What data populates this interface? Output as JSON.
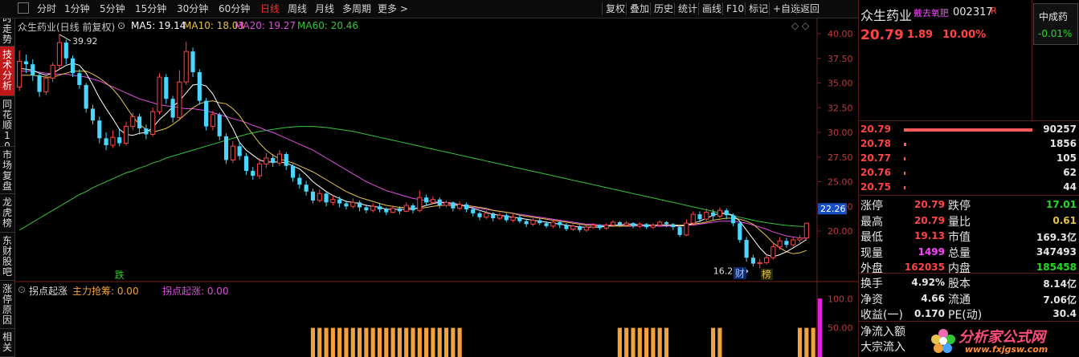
{
  "toolbar": {
    "periods": [
      "分时",
      "1分钟",
      "5分钟",
      "15分钟",
      "30分钟",
      "60分钟",
      "日线",
      "周线",
      "月线",
      "多周期",
      "更多 >"
    ],
    "active_period": "日线",
    "actions": [
      "复权",
      "叠加",
      "历史",
      "统计",
      "画线",
      "F10",
      "标记",
      "+自选",
      "返回"
    ]
  },
  "left_tabs": [
    "分时走势",
    "技术分析",
    "同花顺10",
    "市场复盘",
    "龙虎榜",
    "东财股吧",
    "涨停原因",
    "相关"
  ],
  "active_left_tab": "技术分析",
  "chart": {
    "title": "众生药业(日线 前复权)",
    "ma_legend": [
      {
        "label": "MA5: 19.14",
        "color": "#ffffff"
      },
      {
        "label": "MA10: 18.03",
        "color": "#e6c34a"
      },
      {
        "label": "MA20: 19.27",
        "color": "#e04ce0"
      },
      {
        "label": "MA60: 20.46",
        "color": "#36c436"
      }
    ],
    "price_axis": [
      "40.00",
      "37.50",
      "35.00",
      "32.50",
      "30.00",
      "27.50",
      "25.00",
      "22.50",
      "20.00"
    ],
    "current_price_tag": "22.26",
    "high_label": "39.92",
    "low_label": "16.23",
    "markers": {
      "die": "跌",
      "cai": "财",
      "bang": "榜"
    },
    "indicator_legend": {
      "name": "拐点起涨",
      "zljc": "主力抢筹: 0.00",
      "gdqz": "拐点起涨: 0.00"
    },
    "indicator_axis": [
      "100.0",
      "50.00"
    ],
    "colors": {
      "up": "#ff4444",
      "down": "#4ad6ff",
      "ma5": "#ffffff",
      "ma10": "#e6c34a",
      "ma20": "#e04ce0",
      "ma60": "#36c436",
      "bar": "#f2a23a",
      "bar_peak": "#e020e0"
    }
  },
  "chart_data": {
    "type": "candlestick",
    "ylim": [
      16,
      41
    ],
    "candles": [
      [
        34.6,
        37.2,
        38.3,
        34.2
      ],
      [
        37.2,
        36.9,
        37.9,
        36.0
      ],
      [
        36.9,
        35.8,
        37.4,
        35.2
      ],
      [
        35.8,
        34.1,
        36.1,
        33.6
      ],
      [
        34.1,
        35.5,
        35.9,
        33.8
      ],
      [
        35.5,
        36.8,
        37.1,
        35.1
      ],
      [
        36.8,
        39.1,
        39.92,
        36.4
      ],
      [
        39.1,
        37.5,
        39.4,
        36.9
      ],
      [
        37.5,
        36.0,
        37.8,
        35.6
      ],
      [
        36.0,
        34.8,
        36.4,
        34.4
      ],
      [
        34.8,
        32.4,
        35.0,
        32.0
      ],
      [
        32.4,
        31.2,
        32.8,
        30.8
      ],
      [
        31.2,
        29.4,
        31.6,
        28.9
      ],
      [
        29.4,
        28.7,
        30.0,
        28.2
      ],
      [
        28.7,
        29.5,
        30.2,
        28.4
      ],
      [
        29.5,
        28.9,
        30.3,
        28.6
      ],
      [
        28.9,
        30.6,
        31.1,
        28.7
      ],
      [
        30.6,
        31.6,
        32.0,
        30.2
      ],
      [
        31.6,
        30.4,
        31.9,
        29.8
      ],
      [
        30.4,
        29.8,
        30.8,
        29.3
      ],
      [
        29.8,
        32.1,
        32.5,
        29.6
      ],
      [
        32.1,
        35.6,
        36.0,
        31.8
      ],
      [
        35.6,
        33.4,
        35.9,
        32.9
      ],
      [
        33.4,
        31.5,
        33.7,
        31.0
      ],
      [
        31.5,
        35.1,
        36.3,
        31.2
      ],
      [
        35.1,
        38.2,
        39.2,
        34.8
      ],
      [
        38.2,
        36.1,
        38.6,
        35.6
      ],
      [
        36.1,
        33.2,
        36.4,
        32.8
      ],
      [
        33.2,
        30.6,
        33.5,
        30.2
      ],
      [
        30.6,
        31.8,
        32.2,
        30.2
      ],
      [
        31.8,
        29.6,
        32.0,
        29.2
      ],
      [
        29.6,
        27.2,
        29.9,
        26.8
      ],
      [
        27.2,
        28.6,
        29.1,
        26.9
      ],
      [
        28.6,
        27.6,
        29.0,
        27.2
      ],
      [
        27.6,
        26.1,
        27.9,
        25.7
      ],
      [
        26.1,
        25.6,
        26.5,
        25.2
      ],
      [
        25.6,
        26.8,
        27.4,
        25.3
      ],
      [
        26.8,
        27.4,
        27.9,
        26.4
      ],
      [
        27.4,
        26.9,
        27.8,
        26.5
      ],
      [
        26.9,
        27.8,
        28.2,
        26.6
      ],
      [
        27.8,
        26.6,
        28.0,
        26.2
      ],
      [
        26.6,
        25.4,
        26.8,
        25.0
      ],
      [
        25.4,
        24.7,
        25.8,
        24.3
      ],
      [
        24.7,
        24.0,
        25.1,
        23.6
      ],
      [
        24.0,
        23.1,
        24.3,
        22.8
      ],
      [
        23.1,
        23.8,
        24.2,
        22.9
      ],
      [
        23.8,
        22.9,
        24.0,
        22.5
      ],
      [
        22.9,
        23.2,
        23.6,
        22.6
      ],
      [
        23.2,
        22.8,
        23.5,
        22.4
      ],
      [
        22.8,
        22.5,
        23.1,
        22.2
      ],
      [
        22.5,
        22.9,
        23.3,
        22.3
      ],
      [
        22.9,
        22.4,
        23.1,
        22.0
      ],
      [
        22.4,
        22.1,
        22.7,
        21.8
      ],
      [
        22.1,
        22.5,
        22.8,
        21.9
      ],
      [
        22.5,
        22.2,
        22.8,
        21.9
      ],
      [
        22.2,
        21.9,
        22.4,
        21.6
      ],
      [
        21.9,
        22.3,
        22.6,
        21.8
      ],
      [
        22.3,
        22.0,
        22.5,
        21.7
      ],
      [
        22.0,
        22.6,
        22.9,
        21.9
      ],
      [
        22.6,
        22.1,
        22.8,
        21.8
      ],
      [
        22.1,
        23.4,
        24.1,
        21.9
      ],
      [
        23.4,
        22.9,
        23.7,
        22.6
      ],
      [
        22.9,
        23.2,
        23.5,
        22.7
      ],
      [
        23.2,
        22.6,
        23.4,
        22.3
      ],
      [
        22.6,
        22.9,
        23.1,
        22.4
      ],
      [
        22.9,
        22.3,
        23.0,
        22.0
      ],
      [
        22.3,
        22.7,
        23.0,
        22.1
      ],
      [
        22.7,
        22.2,
        22.9,
        21.9
      ],
      [
        22.2,
        21.8,
        22.4,
        21.5
      ],
      [
        21.8,
        21.4,
        22.0,
        21.1
      ],
      [
        21.4,
        21.8,
        22.1,
        21.2
      ],
      [
        21.8,
        21.3,
        21.9,
        21.0
      ],
      [
        21.3,
        21.6,
        21.9,
        21.1
      ],
      [
        21.6,
        21.1,
        21.8,
        20.9
      ],
      [
        21.1,
        21.4,
        21.7,
        20.9
      ],
      [
        21.4,
        21.0,
        21.6,
        20.8
      ],
      [
        21.0,
        20.7,
        21.2,
        20.4
      ],
      [
        20.7,
        21.1,
        21.3,
        20.5
      ],
      [
        21.1,
        20.8,
        21.3,
        20.6
      ],
      [
        20.8,
        20.5,
        21.0,
        20.3
      ],
      [
        20.5,
        20.9,
        21.1,
        20.3
      ],
      [
        20.9,
        20.6,
        21.0,
        20.3
      ],
      [
        20.6,
        20.2,
        20.8,
        20.0
      ],
      [
        20.2,
        20.5,
        20.7,
        20.0
      ],
      [
        20.5,
        20.1,
        20.6,
        19.9
      ],
      [
        20.1,
        20.4,
        20.6,
        19.9
      ],
      [
        20.4,
        20.6,
        20.8,
        20.2
      ],
      [
        20.6,
        20.3,
        20.7,
        20.1
      ],
      [
        20.3,
        20.6,
        20.8,
        20.1
      ],
      [
        20.6,
        20.9,
        21.1,
        20.4
      ],
      [
        20.9,
        20.6,
        21.0,
        20.4
      ],
      [
        20.6,
        20.8,
        21.0,
        20.4
      ],
      [
        20.8,
        20.5,
        20.9,
        20.3
      ],
      [
        20.5,
        20.7,
        20.9,
        20.3
      ],
      [
        20.7,
        20.4,
        20.8,
        20.2
      ],
      [
        20.4,
        20.6,
        20.8,
        20.2
      ],
      [
        20.6,
        20.9,
        21.1,
        20.4
      ],
      [
        20.9,
        20.7,
        21.0,
        20.4
      ],
      [
        20.7,
        20.4,
        20.8,
        20.1
      ],
      [
        20.4,
        19.6,
        20.5,
        19.4
      ],
      [
        19.6,
        20.8,
        21.2,
        19.5
      ],
      [
        20.8,
        21.7,
        22.0,
        20.6
      ],
      [
        21.7,
        21.2,
        22.0,
        20.9
      ],
      [
        21.2,
        21.9,
        22.3,
        21.0
      ],
      [
        21.9,
        21.5,
        22.2,
        21.1
      ],
      [
        21.5,
        22.1,
        22.4,
        21.3
      ],
      [
        22.1,
        21.6,
        22.3,
        21.2
      ],
      [
        21.6,
        20.8,
        21.8,
        20.5
      ],
      [
        20.8,
        19.1,
        21.0,
        18.8
      ],
      [
        19.1,
        17.3,
        19.4,
        16.9
      ],
      [
        17.3,
        16.7,
        17.6,
        16.4
      ],
      [
        16.7,
        16.8,
        17.2,
        16.23
      ],
      [
        16.8,
        17.3,
        17.6,
        16.6
      ],
      [
        17.3,
        18.4,
        18.7,
        17.1
      ],
      [
        18.4,
        19.0,
        19.4,
        18.1
      ],
      [
        19.0,
        18.6,
        19.3,
        18.3
      ],
      [
        18.6,
        19.1,
        19.4,
        18.4
      ],
      [
        19.1,
        19.3,
        19.6,
        18.8
      ],
      [
        19.3,
        20.79,
        20.79,
        19.13
      ]
    ],
    "ma5": [
      36.5,
      36.4,
      36.3,
      36.0,
      35.8,
      36.0,
      36.4,
      36.8,
      37.0,
      36.8,
      36.0,
      34.8,
      33.5,
      32.4,
      31.4,
      30.3,
      29.8,
      29.7,
      29.9,
      30.0,
      30.5,
      31.3,
      31.9,
      32.6,
      33.2,
      34.0,
      34.8,
      34.9,
      34.7,
      33.9,
      32.6,
      31.6,
      30.4,
      29.0,
      28.2,
      27.7,
      27.2,
      27.0,
      27.0,
      27.0,
      26.9,
      26.6,
      26.3,
      25.7,
      25.0,
      24.5,
      24.0,
      23.6,
      23.3,
      23.0,
      22.9,
      22.8,
      22.6,
      22.5,
      22.4,
      22.2,
      22.2,
      22.2,
      22.2,
      22.2,
      22.4,
      22.6,
      22.8,
      22.9,
      22.9,
      22.8,
      22.7,
      22.5,
      22.3,
      22.1,
      21.9,
      21.7,
      21.6,
      21.5,
      21.4,
      21.3,
      21.2,
      21.1,
      21.0,
      20.9,
      20.8,
      20.7,
      20.6,
      20.5,
      20.4,
      20.4,
      20.4,
      20.4,
      20.5,
      20.6,
      20.6,
      20.7,
      20.7,
      20.6,
      20.6,
      20.6,
      20.6,
      20.6,
      20.6,
      20.5,
      20.6,
      20.8,
      21.0,
      21.3,
      21.6,
      21.8,
      21.8,
      21.6,
      21.0,
      20.1,
      19.2,
      18.3,
      17.6,
      17.4,
      17.6,
      17.9,
      18.3,
      18.7,
      19.14
    ],
    "ma10": [
      35.8,
      35.8,
      35.8,
      35.7,
      35.6,
      35.6,
      35.8,
      36.0,
      36.2,
      36.2,
      36.2,
      35.9,
      35.5,
      35.0,
      34.4,
      33.6,
      32.6,
      31.6,
      30.8,
      30.3,
      30.0,
      30.2,
      30.4,
      30.8,
      31.3,
      31.9,
      32.5,
      32.9,
      33.1,
      33.2,
      33.0,
      32.9,
      32.4,
      31.7,
      30.7,
      29.8,
      28.9,
      28.2,
      27.7,
      27.3,
      27.1,
      26.9,
      26.6,
      26.3,
      26.0,
      25.6,
      25.2,
      24.8,
      24.4,
      24.0,
      23.7,
      23.4,
      23.2,
      23.0,
      22.8,
      22.6,
      22.5,
      22.4,
      22.4,
      22.3,
      22.3,
      22.4,
      22.5,
      22.6,
      22.6,
      22.6,
      22.6,
      22.6,
      22.5,
      22.4,
      22.3,
      22.1,
      22.0,
      21.9,
      21.8,
      21.6,
      21.5,
      21.4,
      21.3,
      21.2,
      21.1,
      21.0,
      20.9,
      20.8,
      20.7,
      20.6,
      20.6,
      20.5,
      20.5,
      20.5,
      20.5,
      20.5,
      20.6,
      20.6,
      20.6,
      20.6,
      20.6,
      20.6,
      20.6,
      20.6,
      20.6,
      20.7,
      20.8,
      20.9,
      21.1,
      21.2,
      21.3,
      21.3,
      21.2,
      21.0,
      20.7,
      20.1,
      19.5,
      18.8,
      18.3,
      17.9,
      17.7,
      17.8,
      18.03
    ],
    "ma20": [
      36.2,
      36.2,
      36.2,
      36.1,
      36.0,
      35.9,
      35.9,
      35.9,
      35.8,
      35.7,
      35.6,
      35.4,
      35.2,
      34.9,
      34.6,
      34.3,
      34.0,
      33.7,
      33.4,
      33.2,
      33.0,
      32.8,
      32.7,
      32.6,
      32.5,
      32.4,
      32.4,
      32.3,
      32.2,
      32.0,
      31.8,
      31.6,
      31.4,
      31.2,
      31.0,
      30.7,
      30.5,
      30.2,
      30.0,
      29.7,
      29.4,
      29.1,
      28.8,
      28.5,
      28.2,
      27.8,
      27.4,
      27.0,
      26.6,
      26.2,
      25.8,
      25.4,
      25.0,
      24.7,
      24.4,
      24.1,
      23.9,
      23.7,
      23.5,
      23.3,
      23.2,
      23.1,
      23.0,
      22.9,
      22.8,
      22.7,
      22.6,
      22.5,
      22.4,
      22.3,
      22.2,
      22.1,
      22.0,
      21.9,
      21.8,
      21.7,
      21.6,
      21.5,
      21.4,
      21.3,
      21.2,
      21.1,
      21.0,
      20.9,
      20.8,
      20.7,
      20.7,
      20.6,
      20.6,
      20.6,
      20.6,
      20.5,
      20.5,
      20.5,
      20.5,
      20.5,
      20.5,
      20.5,
      20.5,
      20.5,
      20.6,
      20.6,
      20.7,
      20.8,
      20.9,
      21.0,
      21.0,
      21.0,
      20.9,
      20.8,
      20.6,
      20.4,
      20.2,
      19.9,
      19.7,
      19.5,
      19.4,
      19.3,
      19.27
    ],
    "ma60": [
      20.1,
      20.5,
      20.9,
      21.3,
      21.7,
      22.1,
      22.5,
      22.9,
      23.3,
      23.7,
      24.0,
      24.4,
      24.7,
      25.0,
      25.3,
      25.6,
      25.9,
      26.1,
      26.4,
      26.6,
      26.9,
      27.1,
      27.4,
      27.6,
      27.8,
      28.0,
      28.2,
      28.4,
      28.6,
      28.8,
      29.0,
      29.2,
      29.4,
      29.6,
      29.8,
      29.95,
      30.1,
      30.2,
      30.3,
      30.4,
      30.5,
      30.55,
      30.6,
      30.6,
      30.6,
      30.55,
      30.5,
      30.4,
      30.3,
      30.2,
      30.1,
      29.95,
      29.8,
      29.65,
      29.5,
      29.35,
      29.2,
      29.05,
      28.9,
      28.75,
      28.6,
      28.45,
      28.3,
      28.15,
      28.0,
      27.85,
      27.7,
      27.55,
      27.4,
      27.25,
      27.1,
      26.95,
      26.8,
      26.65,
      26.5,
      26.35,
      26.2,
      26.05,
      25.9,
      25.75,
      25.6,
      25.45,
      25.3,
      25.15,
      25.0,
      24.85,
      24.7,
      24.55,
      24.4,
      24.25,
      24.1,
      23.95,
      23.8,
      23.65,
      23.5,
      23.35,
      23.2,
      23.05,
      22.9,
      22.75,
      22.6,
      22.45,
      22.3,
      22.15,
      22.0,
      21.85,
      21.7,
      21.55,
      21.4,
      21.25,
      21.1,
      20.95,
      20.85,
      20.75,
      20.65,
      20.58,
      20.52,
      20.48,
      20.46
    ],
    "indicator_ylim": [
      0,
      110
    ],
    "indicator": [
      0,
      0,
      0,
      0,
      0,
      0,
      0,
      0,
      0,
      0,
      0,
      0,
      0,
      0,
      0,
      0,
      0,
      0,
      0,
      0,
      0,
      0,
      0,
      0,
      0,
      0,
      0,
      0,
      0,
      0,
      0,
      0,
      0,
      0,
      0,
      0,
      0,
      0,
      0,
      0,
      0,
      0,
      0,
      0,
      50,
      50,
      50,
      50,
      50,
      50,
      50,
      50,
      50,
      50,
      50,
      50,
      50,
      50,
      50,
      50,
      50,
      50,
      50,
      50,
      50,
      50,
      50,
      0,
      0,
      0,
      0,
      0,
      0,
      0,
      0,
      0,
      0,
      0,
      0,
      0,
      0,
      0,
      0,
      0,
      0,
      0,
      0,
      0,
      0,
      0,
      50,
      50,
      50,
      50,
      50,
      50,
      50,
      50,
      0,
      0,
      0,
      0,
      0,
      0,
      50,
      50,
      0,
      0,
      0,
      0,
      0,
      0,
      0,
      0,
      0,
      0,
      0,
      50,
      50,
      50,
      100,
      0,
      0,
      0
    ]
  },
  "quote": {
    "name": "众生药业",
    "concept": "戴去氧肥",
    "code": "002317",
    "flag": "R",
    "price": "20.79",
    "change": "1.89",
    "pct": "10.00%",
    "sector_name": "中成药",
    "sector_pct": "-0.01%",
    "orderbook": [
      {
        "price": "20.79",
        "vol": "90257",
        "bar": 1.0
      },
      {
        "price": "20.78",
        "vol": "1856",
        "bar": 0.02
      },
      {
        "price": "20.77",
        "vol": "105",
        "bar": 0.01
      },
      {
        "price": "20.76",
        "vol": "62",
        "bar": 0.01
      },
      {
        "price": "20.75",
        "vol": "44",
        "bar": 0.01
      }
    ],
    "stats": [
      {
        "l1": "涨停",
        "v1": "20.79",
        "c1": "red",
        "l2": "跌停",
        "v2": "17.01",
        "c2": "green"
      },
      {
        "l1": "最高",
        "v1": "20.79",
        "c1": "red",
        "l2": "量比",
        "v2": "0.61",
        "c2": "yellow"
      },
      {
        "l1": "最低",
        "v1": "19.13",
        "c1": "red",
        "l2": "市值",
        "v2": "169.3亿",
        "c2": "white"
      },
      {
        "l1": "现量",
        "v1": "1499",
        "c1": "magenta",
        "l2": "总量",
        "v2": "347493",
        "c2": "white"
      },
      {
        "l1": "外盘",
        "v1": "162035",
        "c1": "red",
        "l2": "内盘",
        "v2": "185458",
        "c2": "green"
      }
    ],
    "stats2": [
      {
        "l1": "换手",
        "v1": "4.92%",
        "c1": "white",
        "l2": "股本",
        "v2": "8.14亿",
        "c2": "white"
      },
      {
        "l1": "净资",
        "v1": "4.66",
        "c1": "white",
        "l2": "流通",
        "v2": "7.06亿",
        "c2": "white"
      },
      {
        "l1": "收益(一)",
        "v1": "0.170",
        "c1": "white",
        "l2": "PE(动)",
        "v2": "30.4",
        "c2": "white"
      }
    ],
    "flow": [
      "净流入额",
      "大宗流入"
    ],
    "watermark": "分析家公式网",
    "watermark_url": "www.fxjgsw.com"
  }
}
